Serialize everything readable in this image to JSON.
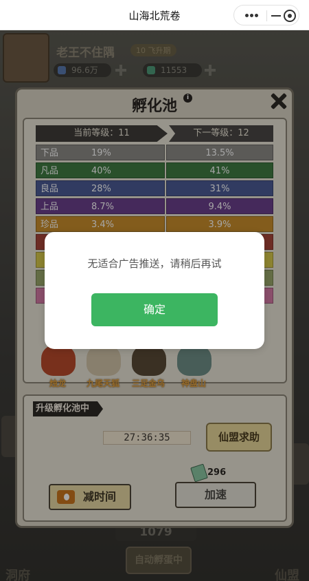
{
  "window": {
    "title": "山海北荒卷"
  },
  "capsule": {
    "more_icon": "more-dots-icon",
    "minimize_icon": "minimize-icon",
    "close_icon": "target-close-icon"
  },
  "header": {
    "player_name": "老王不住隅",
    "level_tag": "10 飞升期",
    "resources": [
      {
        "icon": "diamond-icon",
        "value": "96.6万",
        "color": "#5a7ab0"
      },
      {
        "icon": "jade-icon",
        "value": "11553",
        "color": "#4f9b7a"
      }
    ]
  },
  "bottom": {
    "count": "1079",
    "auto_label": "自动孵蛋中"
  },
  "panel": {
    "title": "孵化池",
    "info_icon": "i",
    "current_level_label": "当前等级：11",
    "next_level_label": "下一等级：12",
    "qualities": [
      {
        "name": "下品",
        "current": "19%",
        "next": "13.5%",
        "color": "#8c8a86"
      },
      {
        "name": "凡品",
        "current": "40%",
        "next": "41%",
        "color": "#3f7c43"
      },
      {
        "name": "良品",
        "current": "28%",
        "next": "31%",
        "color": "#4c5b95"
      },
      {
        "name": "上品",
        "current": "8.7%",
        "next": "9.4%",
        "color": "#6b3f8c"
      },
      {
        "name": "珍品",
        "current": "3.4%",
        "next": "3.9%",
        "color": "#c98e2c"
      },
      {
        "name": "",
        "current": "",
        "next": "",
        "color": "#a8463a"
      },
      {
        "name": "",
        "current": "",
        "next": "",
        "color": "#d8c94a"
      },
      {
        "name": "",
        "current": "",
        "next": "",
        "color": "#9aa86a"
      },
      {
        "name": "",
        "current": "",
        "next": "",
        "color": "#d57aa5"
      }
    ],
    "pets": [
      {
        "name": "烛龙",
        "color": "#b84a2c"
      },
      {
        "name": "九尾天狐",
        "color": "#d2c4a8"
      },
      {
        "name": "三足金乌",
        "color": "#5a4a36"
      },
      {
        "name": "神盘山",
        "color": "#6f8f88"
      }
    ],
    "upgrade": {
      "tag": "升级孵化池中",
      "timer": "27:36:35",
      "help_label": "仙盟求助",
      "speed_cost": "296",
      "reduce_label": "减时间",
      "speed_label": "加速"
    }
  },
  "modal": {
    "message": "无适合广告推送，请稍后再试",
    "confirm_label": "确定"
  }
}
